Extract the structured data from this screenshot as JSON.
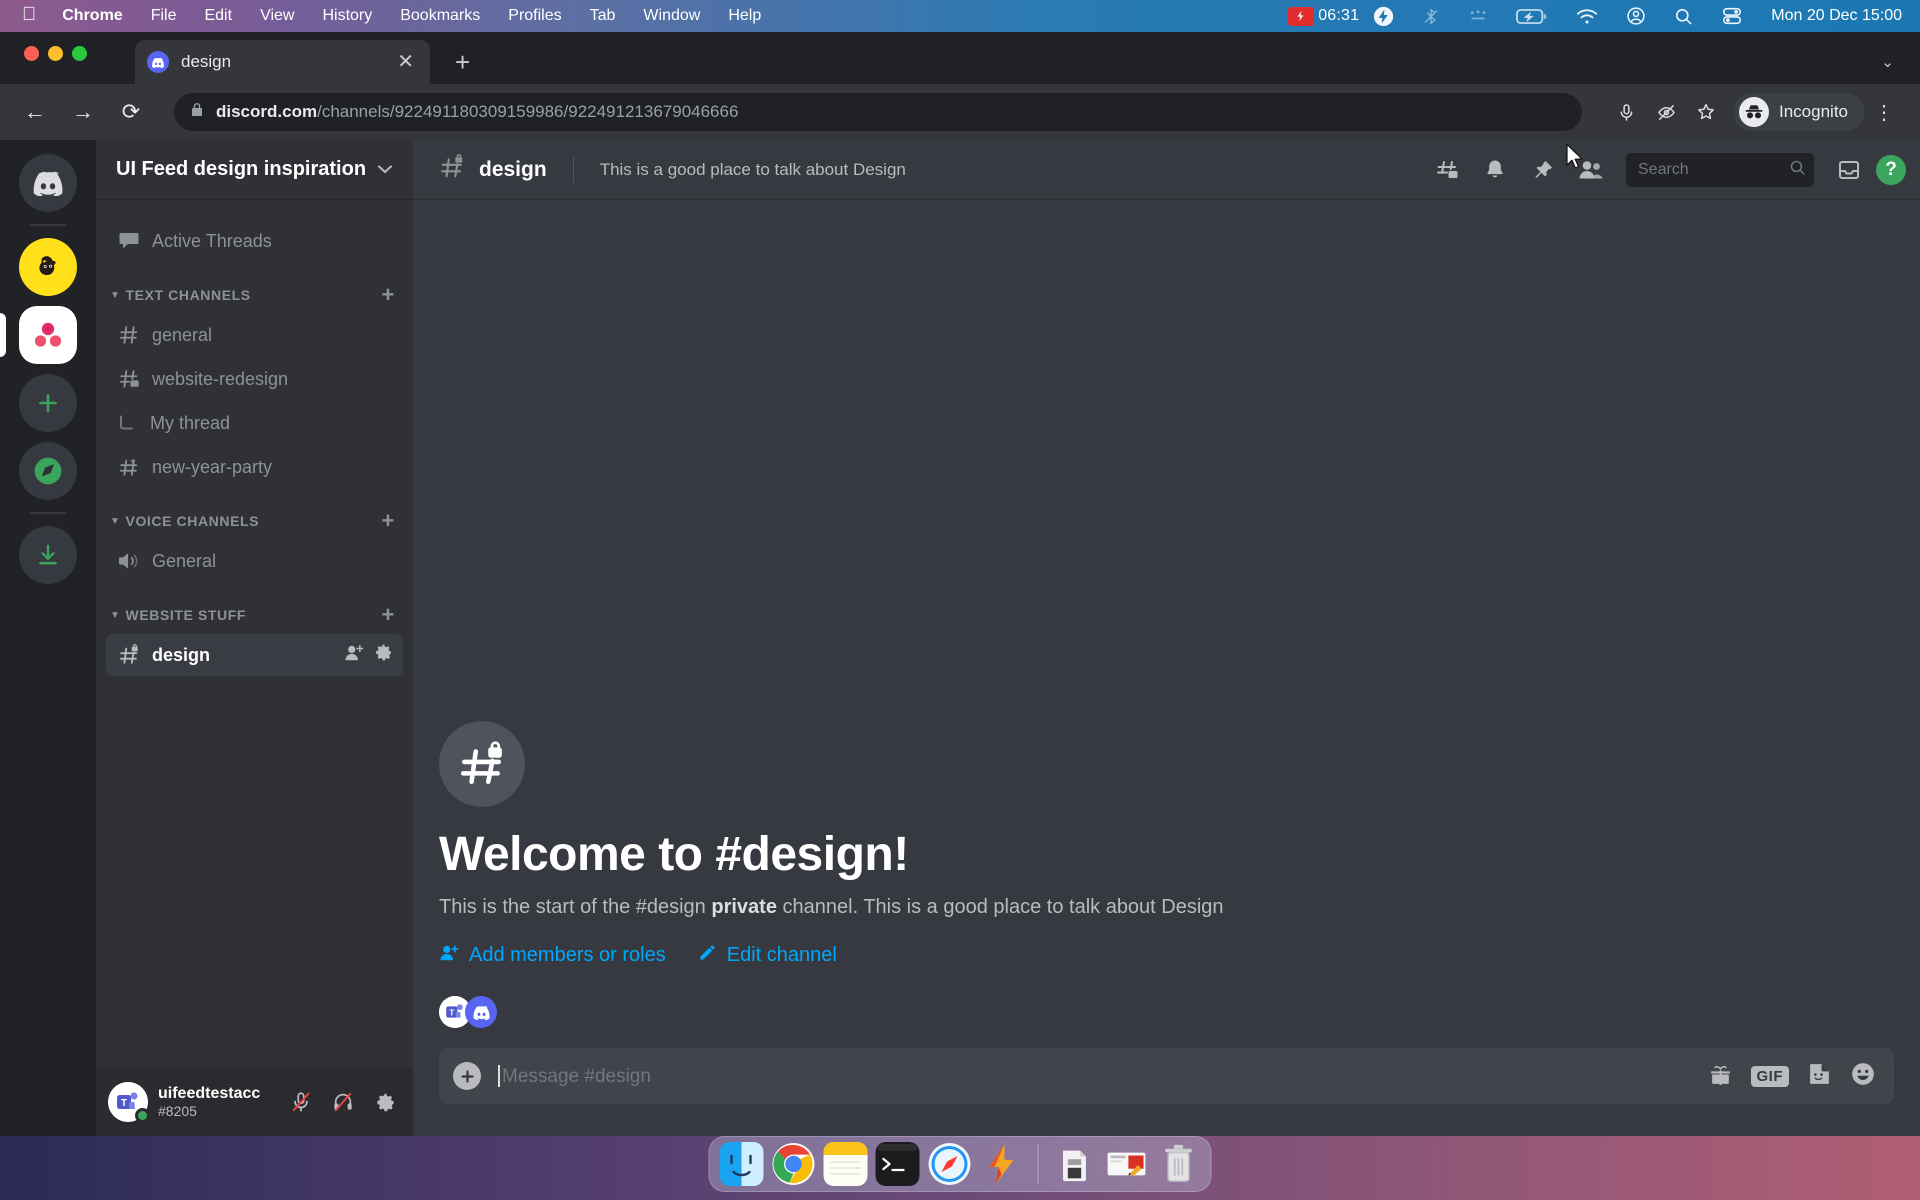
{
  "menubar": {
    "apple": "apple-logo",
    "items": [
      "Chrome",
      "File",
      "Edit",
      "View",
      "History",
      "Bookmarks",
      "Profiles",
      "Tab",
      "Window",
      "Help"
    ],
    "recording_time": "06:31",
    "datetime": "Mon 20 Dec  15:00",
    "status_icons": [
      "screen-record-icon",
      "flash-charging-icon",
      "bluetooth-off-icon",
      "control-dots-icon",
      "battery-charging-icon",
      "wifi-icon",
      "account-icon",
      "search-icon",
      "control-center-icon"
    ]
  },
  "browser": {
    "tab": {
      "title": "design",
      "favicon": "discord-favicon",
      "close": "✕"
    },
    "new_tab": "+",
    "tabstrip_chevron": "⌄",
    "nav": {
      "back": "←",
      "forward": "→",
      "reload": "⟳"
    },
    "omnibox": {
      "lock": "lock-icon",
      "host": "discord.com",
      "path": "/channels/922491180309159986/922491213679046666"
    },
    "toolbar_icons": [
      "microphone-icon",
      "eye-off-icon",
      "bookmark-star-icon"
    ],
    "profile": {
      "label": "Incognito",
      "icon": "incognito-icon"
    },
    "menu": "⋮"
  },
  "discord": {
    "guild_rail": [
      {
        "name": "home-discord",
        "label": "Discord Home",
        "type": "home"
      },
      {
        "name": "guild-mailchimp",
        "label": "Mailchimp",
        "type": "mailchimp"
      },
      {
        "name": "guild-ui-feed",
        "label": "UI Feed design inspiration",
        "type": "active"
      },
      {
        "name": "add-server",
        "label": "Add a Server",
        "type": "plus"
      },
      {
        "name": "explore-servers",
        "label": "Explore Public Servers",
        "type": "compass"
      },
      {
        "name": "download-apps",
        "label": "Download Apps",
        "type": "download"
      }
    ],
    "sidebar": {
      "server_name": "UI Feed design inspiration",
      "chevron": "⌄",
      "active_threads": "Active Threads",
      "categories": [
        {
          "label": "TEXT CHANNELS",
          "add": "+",
          "channels": [
            {
              "name": "general",
              "icon": "hash-icon",
              "selected": false
            },
            {
              "name": "website-redesign",
              "icon": "hash-thread-icon",
              "selected": false
            },
            {
              "name": "My thread",
              "icon": "thread-branch-icon",
              "selected": false,
              "thread": true
            },
            {
              "name": "new-year-party",
              "icon": "hash-event-icon",
              "selected": false
            }
          ]
        },
        {
          "label": "VOICE CHANNELS",
          "add": "+",
          "channels": [
            {
              "name": "General",
              "icon": "speaker-icon",
              "selected": false
            }
          ]
        },
        {
          "label": "WEBSITE STUFF",
          "add": "+",
          "channels": [
            {
              "name": "design",
              "icon": "hash-lock-icon",
              "selected": true,
              "actions": [
                "add-member-icon",
                "gear-icon"
              ]
            }
          ]
        }
      ]
    },
    "user_panel": {
      "username": "uifeedtestacc",
      "discriminator": "#8205",
      "presence": "online",
      "actions": [
        "mute-microphone-icon",
        "deafen-headphone-icon",
        "user-settings-gear-icon"
      ]
    },
    "channel_header": {
      "icon": "hash-lock-icon",
      "name": "design",
      "topic": "This is a good place to talk about Design",
      "actions": [
        "threads-icon",
        "notification-bell-icon",
        "pinned-messages-icon",
        "member-list-icon"
      ],
      "search_placeholder": "Search",
      "inbox": "inbox-icon",
      "help": "?"
    },
    "welcome": {
      "icon": "hash-lock-icon",
      "heading": "Welcome to #design!",
      "body_before": "This is the start of the #design ",
      "body_bold": "private",
      "body_after": " channel. This is a good place to talk about Design",
      "links": [
        {
          "label": "Add members or roles",
          "icon": "add-person-icon"
        },
        {
          "label": "Edit channel",
          "icon": "pencil-icon"
        }
      ],
      "facepile": [
        "teams-avatar",
        "discord-avatar"
      ]
    },
    "composer": {
      "plus": "+",
      "placeholder": "Message #design",
      "actions": [
        "gift-icon",
        "GIF",
        "sticker-icon",
        "emoji-icon"
      ]
    }
  },
  "dock": {
    "items": [
      {
        "name": "finder",
        "label": "Finder",
        "running": true
      },
      {
        "name": "chrome",
        "label": "Google Chrome",
        "running": true
      },
      {
        "name": "notes",
        "label": "Notes",
        "running": true
      },
      {
        "name": "terminal",
        "label": "Terminal",
        "running": true
      },
      {
        "name": "safari",
        "label": "Safari",
        "running": true
      },
      {
        "name": "flash",
        "label": "Flash",
        "running": true
      }
    ],
    "right_items": [
      {
        "name": "downloads-stack",
        "label": "Downloads"
      },
      {
        "name": "file-preview",
        "label": "Recent File"
      },
      {
        "name": "trash",
        "label": "Trash"
      }
    ]
  },
  "colors": {
    "discord_blurple": "#5865F2",
    "accent_link": "#00a8fc",
    "online_green": "#3ba55d",
    "sidebar_bg": "#2f3136",
    "rail_bg": "#202225",
    "main_bg": "#36393f"
  }
}
